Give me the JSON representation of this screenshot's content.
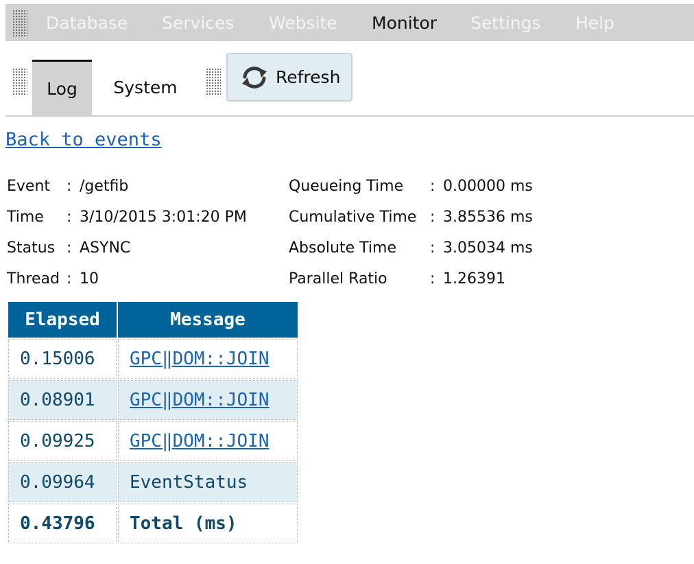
{
  "menubar": {
    "items": [
      {
        "label": "Database",
        "active": false
      },
      {
        "label": "Services",
        "active": false
      },
      {
        "label": "Website",
        "active": false
      },
      {
        "label": "Monitor",
        "active": true
      },
      {
        "label": "Settings",
        "active": false
      },
      {
        "label": "Help",
        "active": false
      }
    ]
  },
  "toolbar": {
    "tabs": [
      {
        "label": "Log",
        "active": true
      },
      {
        "label": "System",
        "active": false
      }
    ],
    "refresh_label": "Refresh",
    "refresh_icon": "refresh-icon"
  },
  "back_link": "Back to events",
  "details": {
    "left": [
      {
        "key": "Event",
        "sep": ":",
        "value": "/getfib"
      },
      {
        "key": "Time",
        "sep": ":",
        "value": "3/10/2015 3:01:20 PM"
      },
      {
        "key": "Status",
        "sep": ":",
        "value": "ASYNC"
      },
      {
        "key": "Thread",
        "sep": ":",
        "value": "10"
      }
    ],
    "right": [
      {
        "key": "Queueing Time",
        "sep": ":",
        "value": "0.00000 ms"
      },
      {
        "key": "Cumulative Time",
        "sep": ":",
        "value": "3.85536 ms"
      },
      {
        "key": "Absolute Time",
        "sep": ":",
        "value": "3.05034 ms"
      },
      {
        "key": "Parallel Ratio",
        "sep": ":",
        "value": "1.26391"
      }
    ]
  },
  "log_table": {
    "headers": [
      "Elapsed",
      "Message"
    ],
    "rows": [
      {
        "elapsed": "0.15006",
        "message": "GPC‖DOM::JOIN",
        "link": true
      },
      {
        "elapsed": "0.08901",
        "message": "GPC‖DOM::JOIN",
        "link": true
      },
      {
        "elapsed": "0.09925",
        "message": "GPC‖DOM::JOIN",
        "link": true
      },
      {
        "elapsed": "0.09964",
        "message": "EventStatus",
        "link": false
      }
    ],
    "total": {
      "elapsed": "0.43796",
      "label": "Total (ms)"
    }
  },
  "colors": {
    "menubar_bg": "#d2d2d2",
    "table_header": "#006399",
    "alt_row": "#e0edf3",
    "link": "#1a63b8"
  }
}
